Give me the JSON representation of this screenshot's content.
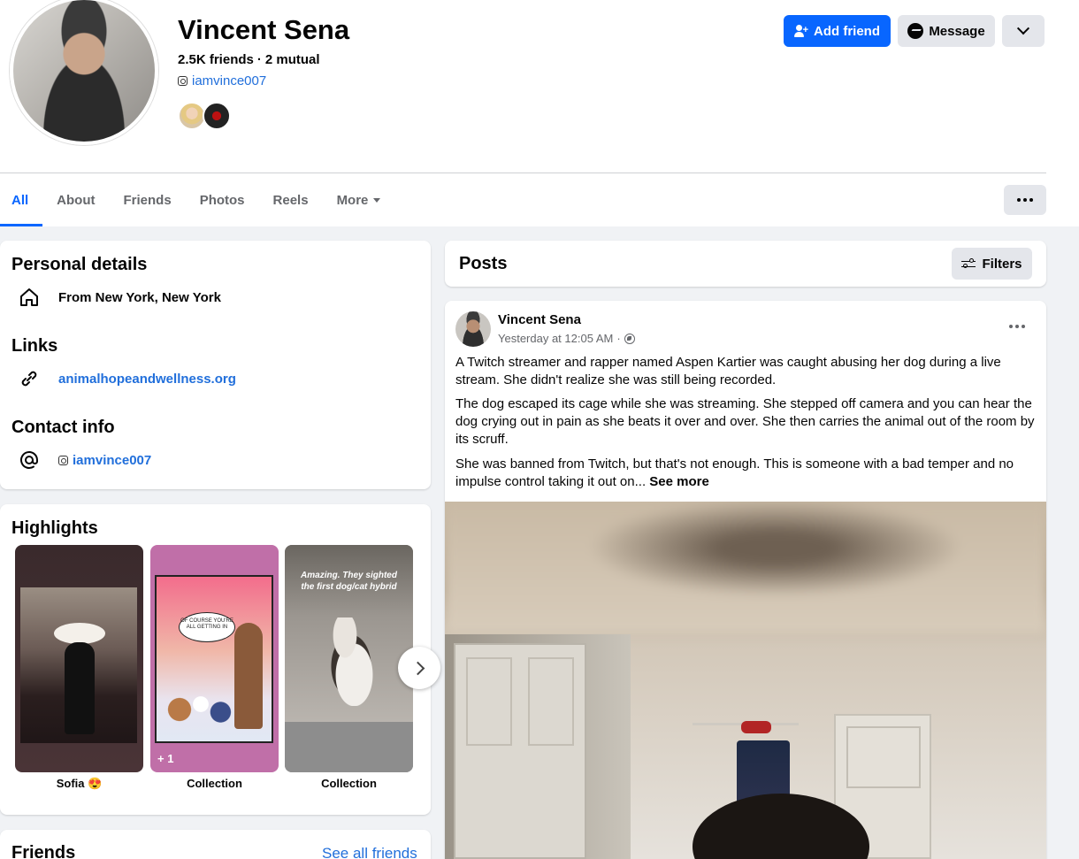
{
  "profile": {
    "name": "Vincent Sena",
    "friends": "2.5K friends",
    "mutual": "2 mutual",
    "instagram": "iamvince007"
  },
  "actions": {
    "add_friend": "Add friend",
    "message": "Message"
  },
  "tabs": [
    {
      "label": "All",
      "active": true
    },
    {
      "label": "About"
    },
    {
      "label": "Friends"
    },
    {
      "label": "Photos"
    },
    {
      "label": "Reels"
    },
    {
      "label": "More"
    }
  ],
  "personal_details": {
    "title": "Personal details",
    "from": "From New York, New York"
  },
  "links": {
    "title": "Links",
    "url": "animalhopeandwellness.org"
  },
  "contact": {
    "title": "Contact info",
    "instagram": "iamvince007"
  },
  "highlights": {
    "title": "Highlights",
    "items": [
      {
        "label": "Sofia 😍"
      },
      {
        "label": "Collection",
        "badge": "+ 1",
        "bubble": "OF COURSE YOU'RE ALL GETTING IN"
      },
      {
        "label": "Collection",
        "caption": "Amazing. They sighted the first dog/cat hybrid"
      }
    ]
  },
  "friends_section": {
    "title": "Friends",
    "see_all": "See all friends"
  },
  "posts": {
    "title": "Posts",
    "filters": "Filters"
  },
  "post": {
    "author": "Vincent Sena",
    "time": "Yesterday at 12:05 AM",
    "separator": "·",
    "p1": "A Twitch streamer and rapper named Aspen Kartier was caught abusing her dog during a live stream. She didn't realize she was still being recorded.",
    "p2": "The dog escaped its cage while she was streaming. She stepped off camera and you can hear the dog crying out in pain as she beats it over and over. She then carries the animal out of the room by its scruff.",
    "p3": "She was banned from Twitch, but that's not enough. This is someone with a bad temper and no impulse control taking it out on...",
    "see_more": "See more"
  },
  "colors": {
    "accent": "#0866ff",
    "link": "#216fdb",
    "background": "#f0f2f5"
  }
}
